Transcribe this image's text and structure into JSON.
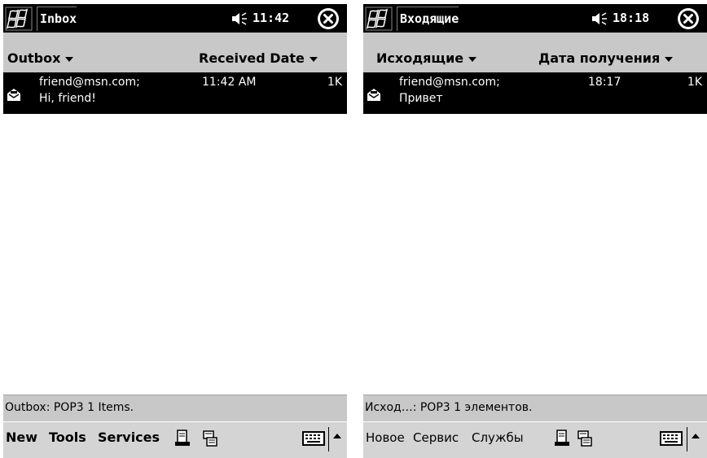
{
  "colors": {
    "bar_bg": "#000000",
    "band_bg": "#c8c8c8",
    "menu_bg": "#d4d4d4",
    "list_bg": "#ffffff",
    "text_light": "#ffffff"
  },
  "left": {
    "title": "Inbox",
    "time": "11:42",
    "folder_label": "Outbox",
    "sort_label": "Received Date",
    "message": {
      "sender": "friend@msn.com;",
      "subject": "Hi, friend!",
      "time": "11:42 AM",
      "size": "1K",
      "icon": "opened-envelope-icon"
    },
    "status": "Outbox: POP3  1 Items.",
    "menu": {
      "new": "New",
      "tools": "Tools",
      "services": "Services"
    },
    "icons": [
      "windows-flag-icon",
      "speaker-icon",
      "close-icon",
      "send-receive-icon",
      "folder-list-icon",
      "keyboard-icon",
      "chevron-up-icon"
    ]
  },
  "right": {
    "title": "Входящие",
    "time": "18:18",
    "folder_label": "Исходящие",
    "sort_label": "Дата получения",
    "message": {
      "sender": "friend@msn.com;",
      "subject": "Привет",
      "time": "18:17",
      "size": "1K",
      "icon": "opened-envelope-icon"
    },
    "status": "Исход…: POP3  1 элементов.",
    "menu": {
      "new": "Новое",
      "tools": "Сервис",
      "services": "Службы"
    },
    "icons": [
      "windows-flag-icon",
      "speaker-icon",
      "close-icon",
      "send-receive-icon",
      "folder-list-icon",
      "keyboard-icon",
      "chevron-up-icon"
    ]
  }
}
